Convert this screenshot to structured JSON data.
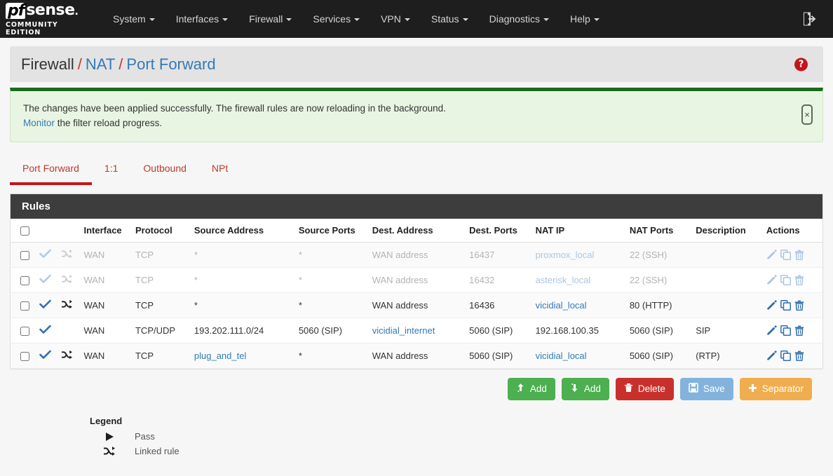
{
  "navbar": {
    "brand": {
      "pf": "pf",
      "sense": "sense",
      "subtitle": "COMMUNITY EDITION"
    },
    "items": [
      {
        "label": "System",
        "icon": "chevron-down-icon"
      },
      {
        "label": "Interfaces",
        "icon": "chevron-down-icon"
      },
      {
        "label": "Firewall",
        "icon": "chevron-down-icon"
      },
      {
        "label": "Services",
        "icon": "chevron-down-icon"
      },
      {
        "label": "VPN",
        "icon": "chevron-down-icon"
      },
      {
        "label": "Status",
        "icon": "chevron-down-icon"
      },
      {
        "label": "Diagnostics",
        "icon": "chevron-down-icon"
      },
      {
        "label": "Help",
        "icon": "chevron-down-icon"
      }
    ],
    "logout_icon": "logout-icon"
  },
  "breadcrumb": {
    "root": "Firewall",
    "sep": "/",
    "mid": "NAT",
    "leaf": "Port Forward",
    "help_icon": "help-icon",
    "help_glyph": "?"
  },
  "alert": {
    "line1": "The changes have been applied successfully. The firewall rules are now reloading in the background.",
    "link": "Monitor",
    "line2_rest": " the filter reload progress.",
    "close_glyph": "×",
    "accent_color": "#1a6b1a",
    "bg_color": "#e8f5e3"
  },
  "tabs": [
    {
      "label": "Port Forward",
      "active": true
    },
    {
      "label": "1:1",
      "active": false
    },
    {
      "label": "Outbound",
      "active": false
    },
    {
      "label": "NPt",
      "active": false
    }
  ],
  "table": {
    "title": "Rules",
    "columns": [
      "",
      "",
      "",
      "Interface",
      "Protocol",
      "Source Address",
      "Source Ports",
      "Dest. Address",
      "Dest. Ports",
      "NAT IP",
      "NAT Ports",
      "Description",
      "Actions"
    ],
    "headers": {
      "interface": "Interface",
      "protocol": "Protocol",
      "source_address": "Source Address",
      "source_ports": "Source Ports",
      "dest_address": "Dest. Address",
      "dest_ports": "Dest. Ports",
      "nat_ip": "NAT IP",
      "nat_ports": "NAT Ports",
      "description": "Description",
      "actions": "Actions"
    },
    "rows": [
      {
        "disabled": true,
        "linked": true,
        "interface": "WAN",
        "protocol": "TCP",
        "source_address": "*",
        "source_address_link": false,
        "source_ports": "*",
        "dest_address": "WAN address",
        "dest_address_link": false,
        "dest_ports": "16437",
        "nat_ip": "proxmox_local",
        "nat_ip_link": true,
        "nat_ports": "22 (SSH)",
        "description": ""
      },
      {
        "disabled": true,
        "linked": true,
        "interface": "WAN",
        "protocol": "TCP",
        "source_address": "*",
        "source_address_link": false,
        "source_ports": "*",
        "dest_address": "WAN address",
        "dest_address_link": false,
        "dest_ports": "16432",
        "nat_ip": "asterisk_local",
        "nat_ip_link": true,
        "nat_ports": "22 (SSH)",
        "description": ""
      },
      {
        "disabled": false,
        "linked": true,
        "interface": "WAN",
        "protocol": "TCP",
        "source_address": "*",
        "source_address_link": false,
        "source_ports": "*",
        "dest_address": "WAN address",
        "dest_address_link": false,
        "dest_ports": "16436",
        "nat_ip": "vicidial_local",
        "nat_ip_link": true,
        "nat_ports": "80 (HTTP)",
        "description": ""
      },
      {
        "disabled": false,
        "linked": false,
        "interface": "WAN",
        "protocol": "TCP/UDP",
        "source_address": "193.202.111.0/24",
        "source_address_link": false,
        "source_ports": "5060 (SIP)",
        "dest_address": "vicidial_internet",
        "dest_address_link": true,
        "dest_ports": "5060 (SIP)",
        "nat_ip": "192.168.100.35",
        "nat_ip_link": false,
        "nat_ports": "5060 (SIP)",
        "description": "SIP"
      },
      {
        "disabled": false,
        "linked": true,
        "interface": "WAN",
        "protocol": "TCP",
        "source_address": "plug_and_tel",
        "source_address_link": true,
        "source_ports": "*",
        "dest_address": "WAN address",
        "dest_address_link": false,
        "dest_ports": "5060 (SIP)",
        "nat_ip": "vicidial_local",
        "nat_ip_link": true,
        "nat_ports": "5060 (SIP)",
        "description": "(RTP)"
      }
    ],
    "row_actions": [
      {
        "name": "edit-icon",
        "title": "Edit"
      },
      {
        "name": "copy-icon",
        "title": "Copy"
      },
      {
        "name": "delete-icon",
        "title": "Delete"
      }
    ]
  },
  "buttons": [
    {
      "label": "Add",
      "icon": "arrow-up-icon",
      "color": "#4caf50",
      "style": "btn-green"
    },
    {
      "label": "Add",
      "icon": "arrow-down-icon",
      "color": "#4caf50",
      "style": "btn-green"
    },
    {
      "label": "Delete",
      "icon": "trash-icon",
      "color": "#c9302c",
      "style": "btn-red"
    },
    {
      "label": "Save",
      "icon": "save-icon",
      "color": "#83b3dd",
      "style": "btn-blue"
    },
    {
      "label": "Separator",
      "icon": "plus-icon",
      "color": "#f0ad4e",
      "style": "btn-orange"
    }
  ],
  "legend": {
    "title": "Legend",
    "items": [
      {
        "icon": "play-triangle-icon",
        "label": "Pass"
      },
      {
        "icon": "shuffle-icon",
        "label": "Linked rule"
      }
    ]
  }
}
